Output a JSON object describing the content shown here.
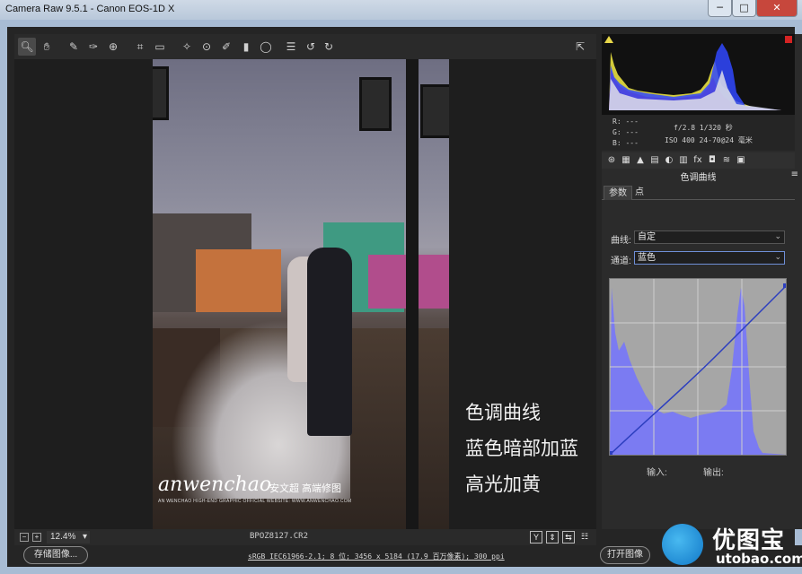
{
  "window": {
    "title": "Camera Raw 9.5.1 -  Canon EOS-1D X",
    "minimize": "─",
    "maximize": "□",
    "close": "✕"
  },
  "toolbar": {
    "tools": [
      {
        "name": "zoom-tool",
        "glyph": "🔍︎"
      },
      {
        "name": "hand-tool",
        "glyph": "✋︎"
      },
      {
        "name": "white-balance-tool",
        "glyph": "✎"
      },
      {
        "name": "color-sampler-tool",
        "glyph": "✑"
      },
      {
        "name": "targeted-adjustment-tool",
        "glyph": "⊕"
      },
      {
        "name": "crop-tool",
        "glyph": "⌗"
      },
      {
        "name": "straighten-tool",
        "glyph": "▭"
      },
      {
        "name": "spot-removal-tool",
        "glyph": "✧"
      },
      {
        "name": "red-eye-tool",
        "glyph": "⊙"
      },
      {
        "name": "adjustment-brush-tool",
        "glyph": "✐"
      },
      {
        "name": "graduated-filter-tool",
        "glyph": "▮"
      },
      {
        "name": "radial-filter-tool",
        "glyph": "◯"
      },
      {
        "name": "preferences-tool",
        "glyph": "☰"
      },
      {
        "name": "rotate-left-tool",
        "glyph": "↺"
      },
      {
        "name": "rotate-right-tool",
        "glyph": "↻"
      }
    ],
    "fullscreen_glyph": "⇱"
  },
  "overlay": {
    "line1": "色调曲线",
    "line2": "蓝色暗部加蓝",
    "line3": "高光加黄"
  },
  "watermark": {
    "brand": "anwenchao",
    "cn": "安文超 高端修图",
    "sub": "AN WENCHAO HIGH-END GRAPHIC OFFICIAL WEBSITE: WWW.ANWENCHAO.COM"
  },
  "statusbar": {
    "zoom_out": "−",
    "zoom_in": "+",
    "zoom": "12.4%",
    "zoom_chev": "▾",
    "filename": "BPOZ8127.CR2",
    "icons": [
      "Y",
      "⇕",
      "⇆",
      "☷"
    ]
  },
  "bottombar": {
    "save_button": "存储图像...",
    "workflow_link": "sRGB IEC61966-2.1; 8 位; 3456 x 5184 (17.9 百万像素); 300 ppi",
    "open_button": "打开图像"
  },
  "info": {
    "r": "R:  ---",
    "g": "G:  ---",
    "b": "B:  ---",
    "aperture_shutter": "f/2.8  1/320 秒",
    "iso_lens": "ISO 400  24-70@24 毫米"
  },
  "panel": {
    "tab_icons": [
      "⊛",
      "▦",
      "▲",
      "▤",
      "◐",
      "▥",
      "fx",
      "◘",
      "≋",
      "▣"
    ],
    "section_title": "色调曲线",
    "menu_glyph": "≡",
    "subtabs": [
      "参数",
      "点"
    ],
    "curve_label": "曲线:",
    "curve_value": "自定",
    "channel_label": "通道:",
    "channel_value": "蓝色",
    "chev": "⌄",
    "input_label": "输入:",
    "output_label": "输出:"
  },
  "logo": {
    "cn": "优图宝",
    "en": "utobao.com"
  },
  "colors": {
    "curve_fill": "#7b7bf2",
    "curve_line": "#2d3fbf",
    "histogram_red": "#e03030",
    "histogram_yellow": "#e8e040",
    "histogram_blue": "#3048ff"
  }
}
